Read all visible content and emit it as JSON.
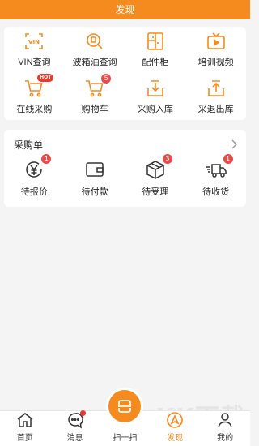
{
  "header": {
    "title": "发现"
  },
  "colors": {
    "brand": "#f58a1f",
    "badge": "#e94a4a"
  },
  "grid": [
    {
      "label": "VIN查询",
      "icon": "vin-scan-icon"
    },
    {
      "label": "波箱油查询",
      "icon": "oil-search-icon"
    },
    {
      "label": "配件柜",
      "icon": "parts-cabinet-icon"
    },
    {
      "label": "培训视频",
      "icon": "training-video-icon"
    },
    {
      "label": "在线采购",
      "icon": "online-purchase-cart-icon",
      "tag": "HOT"
    },
    {
      "label": "购物车",
      "icon": "shopping-cart-icon",
      "badge": "5"
    },
    {
      "label": "采购入库",
      "icon": "purchase-in-icon"
    },
    {
      "label": "采退出库",
      "icon": "return-out-icon"
    }
  ],
  "orders": {
    "title": "采购单",
    "items": [
      {
        "label": "待报价",
        "icon": "quote-yen-icon",
        "badge": "1"
      },
      {
        "label": "待付款",
        "icon": "wallet-icon",
        "badge": ""
      },
      {
        "label": "待受理",
        "icon": "package-box-icon",
        "badge": "3"
      },
      {
        "label": "待收货",
        "icon": "delivery-truck-icon",
        "badge": "1"
      }
    ]
  },
  "tabs": [
    {
      "label": "首页",
      "icon": "home-icon"
    },
    {
      "label": "消息",
      "icon": "message-icon"
    },
    {
      "label": "扫一扫",
      "icon": "scan-icon"
    },
    {
      "label": "发现",
      "icon": "discover-icon"
    },
    {
      "label": "我的",
      "icon": "profile-icon"
    }
  ],
  "watermark": {
    "big": "KK下载",
    "small": "www.kkx.net"
  }
}
